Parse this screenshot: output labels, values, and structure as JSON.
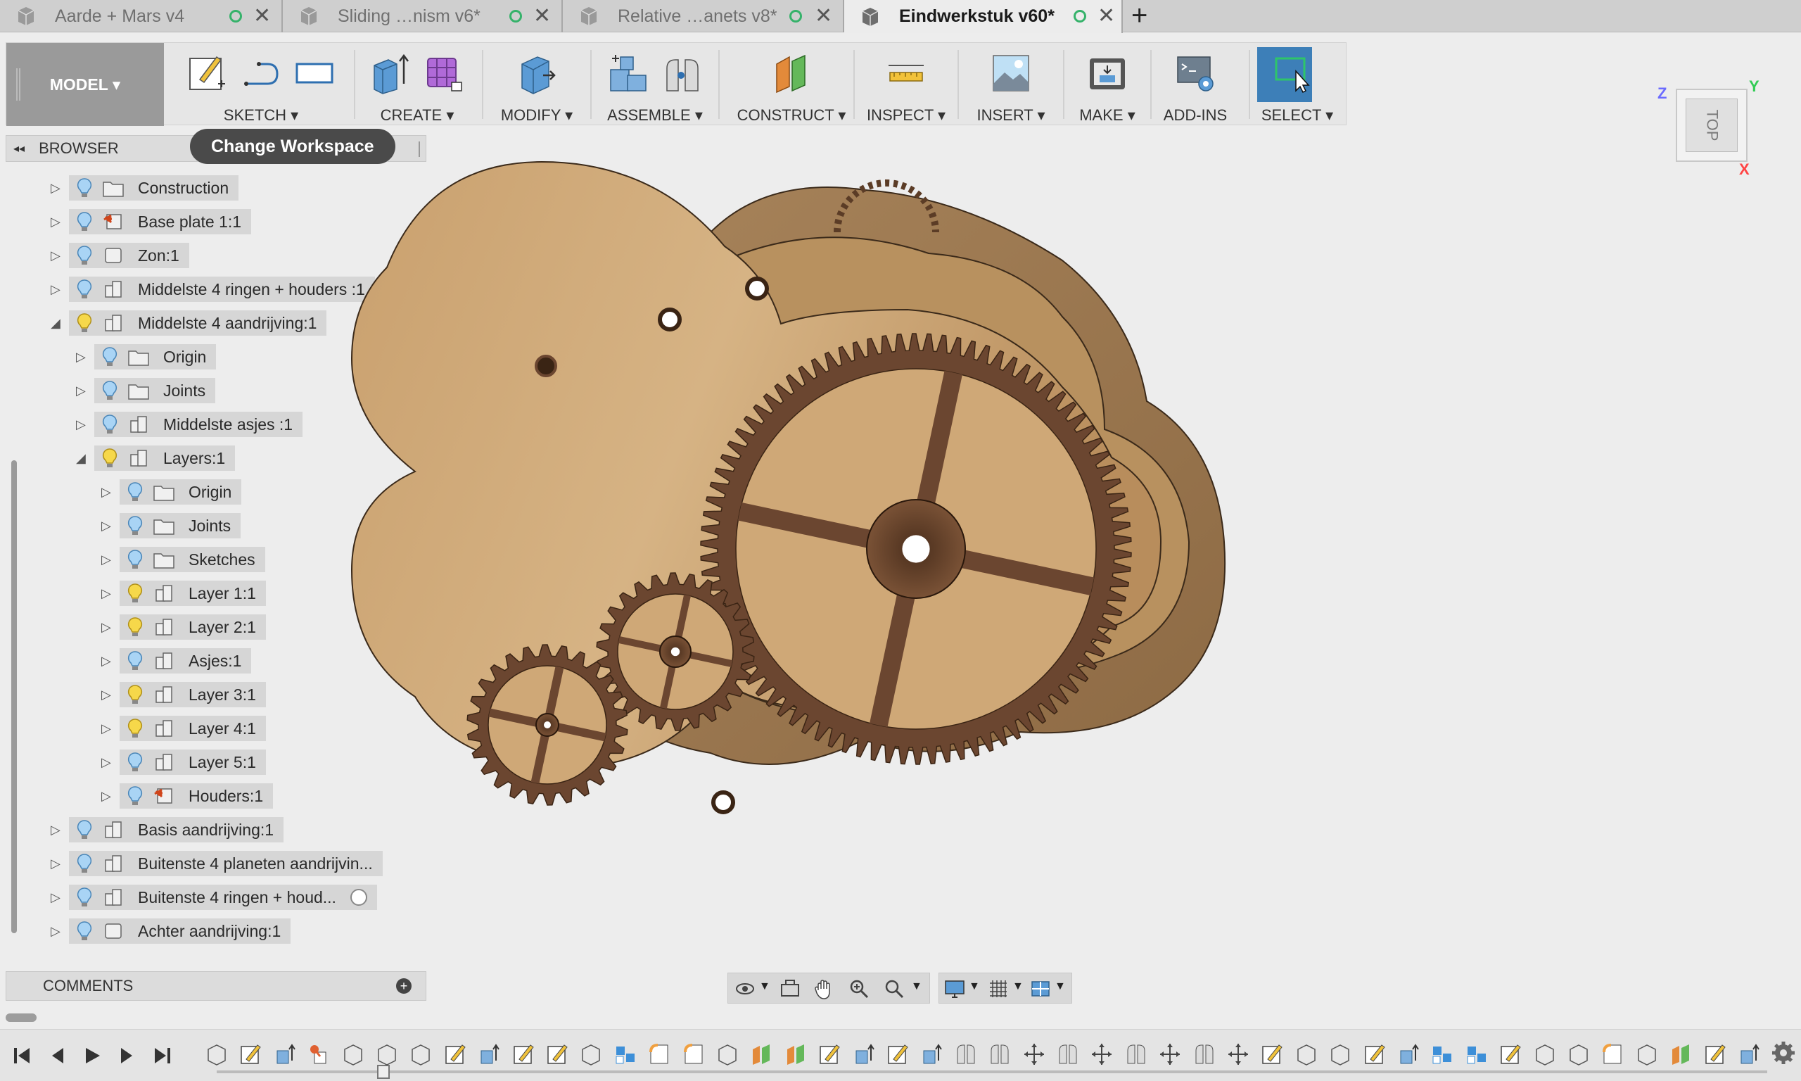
{
  "tabs": [
    {
      "label": "Aarde + Mars v4",
      "active": false
    },
    {
      "label": "Sliding …nism v6*",
      "active": false
    },
    {
      "label": "Relative …anets v8*",
      "active": false
    },
    {
      "label": "Eindwerkstuk v60*",
      "active": true
    }
  ],
  "new_tab": "+",
  "close_glyph": "✕",
  "toolbar": {
    "workspace": "MODEL ▾",
    "groups": [
      {
        "label": "SKETCH ▾"
      },
      {
        "label": "CREATE ▾"
      },
      {
        "label": "MODIFY ▾"
      },
      {
        "label": "ASSEMBLE ▾"
      },
      {
        "label": "CONSTRUCT ▾"
      },
      {
        "label": "INSPECT ▾"
      },
      {
        "label": "INSERT ▾"
      },
      {
        "label": "MAKE ▾"
      },
      {
        "label": "ADD-INS"
      },
      {
        "label": "SELECT ▾"
      }
    ]
  },
  "tooltip": "Change Workspace",
  "browser": {
    "title": "BROWSER",
    "collapse_glyph": "◂◂",
    "items": [
      {
        "label": "Construction",
        "depth": 0,
        "expanded": false,
        "type": "folder",
        "bulb": "blue"
      },
      {
        "label": "Base plate 1:1",
        "depth": 0,
        "expanded": false,
        "type": "component-pinned",
        "bulb": "blue"
      },
      {
        "label": "Zon:1",
        "depth": 0,
        "expanded": false,
        "type": "body",
        "bulb": "blue"
      },
      {
        "label": "Middelste 4 ringen + houders :1",
        "depth": 0,
        "expanded": false,
        "type": "component",
        "bulb": "blue"
      },
      {
        "label": "Middelste 4 aandrijving:1",
        "depth": 0,
        "expanded": true,
        "type": "component",
        "bulb": "yellow"
      },
      {
        "label": "Origin",
        "depth": 1,
        "expanded": false,
        "type": "folder",
        "bulb": "blue"
      },
      {
        "label": "Joints",
        "depth": 1,
        "expanded": false,
        "type": "folder",
        "bulb": "blue"
      },
      {
        "label": "Middelste asjes :1",
        "depth": 1,
        "expanded": false,
        "type": "component",
        "bulb": "blue"
      },
      {
        "label": "Layers:1",
        "depth": 1,
        "expanded": true,
        "type": "component",
        "bulb": "yellow"
      },
      {
        "label": "Origin",
        "depth": 2,
        "expanded": false,
        "type": "folder",
        "bulb": "blue"
      },
      {
        "label": "Joints",
        "depth": 2,
        "expanded": false,
        "type": "folder",
        "bulb": "blue"
      },
      {
        "label": "Sketches",
        "depth": 2,
        "expanded": false,
        "type": "folder",
        "bulb": "blue"
      },
      {
        "label": "Layer 1:1",
        "depth": 2,
        "expanded": false,
        "type": "component",
        "bulb": "yellow"
      },
      {
        "label": "Layer 2:1",
        "depth": 2,
        "expanded": false,
        "type": "component",
        "bulb": "yellow"
      },
      {
        "label": "Asjes:1",
        "depth": 2,
        "expanded": false,
        "type": "component",
        "bulb": "blue"
      },
      {
        "label": "Layer 3:1",
        "depth": 2,
        "expanded": false,
        "type": "component",
        "bulb": "yellow"
      },
      {
        "label": "Layer 4:1",
        "depth": 2,
        "expanded": false,
        "type": "component",
        "bulb": "yellow"
      },
      {
        "label": "Layer 5:1",
        "depth": 2,
        "expanded": false,
        "type": "component",
        "bulb": "blue"
      },
      {
        "label": "Houders:1",
        "depth": 2,
        "expanded": false,
        "type": "component-pinned",
        "bulb": "blue"
      },
      {
        "label": "Basis aandrijving:1",
        "depth": 0,
        "expanded": false,
        "type": "component",
        "bulb": "blue"
      },
      {
        "label": "Buitenste 4 planeten aandrijvin...",
        "depth": 0,
        "expanded": false,
        "type": "component",
        "bulb": "blue"
      },
      {
        "label": "Buitenste 4 ringen + houd...",
        "depth": 0,
        "expanded": false,
        "type": "component",
        "bulb": "blue",
        "radio": true
      },
      {
        "label": "Achter aandrijving:1",
        "depth": 0,
        "expanded": false,
        "type": "body",
        "bulb": "blue"
      }
    ]
  },
  "comments": {
    "title": "COMMENTS",
    "add_glyph": "+"
  },
  "viewcube": {
    "face": "TOP",
    "axis_z": "Z",
    "axis_y": "Y",
    "axis_x": "X",
    "color_z": "#6b6bff",
    "color_y": "#33cc55",
    "color_x": "#ff4444"
  },
  "colors": {
    "accent": "#3d7fb8",
    "wood_light": "#c8a276",
    "wood_dark": "#6b4630",
    "sync": "#35b26a"
  }
}
